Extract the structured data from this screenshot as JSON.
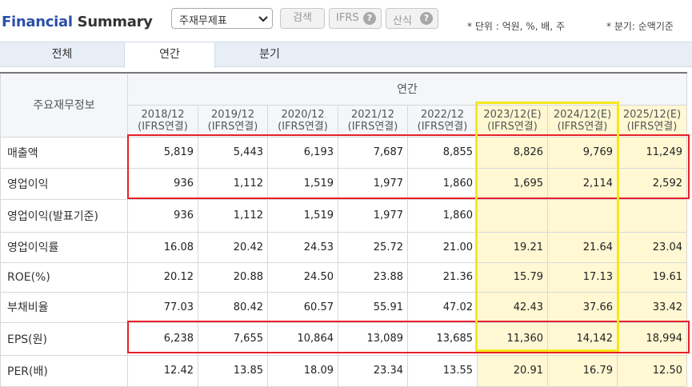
{
  "header": {
    "title_part1": "Financial",
    "title_part2": "Summary",
    "statement_select": "주재무제표",
    "search_label": "검색",
    "ifrs_label": "IFRS",
    "formula_label": "산식",
    "help_icon": "question-circle-icon",
    "unit_note": "* 단위 : 억원, %, 배, 주",
    "quarter_note": "* 분기: 순액기준"
  },
  "tabs": [
    "전체",
    "연간",
    "분기"
  ],
  "active_tab": "연간",
  "table": {
    "corner_label": "주요재무정보",
    "group_label": "연간",
    "columns": [
      {
        "period": "2018/12",
        "basis": "(IFRS연결)",
        "estimate": false
      },
      {
        "period": "2019/12",
        "basis": "(IFRS연결)",
        "estimate": false
      },
      {
        "period": "2020/12",
        "basis": "(IFRS연결)",
        "estimate": false
      },
      {
        "period": "2021/12",
        "basis": "(IFRS연결)",
        "estimate": false
      },
      {
        "period": "2022/12",
        "basis": "(IFRS연결)",
        "estimate": false
      },
      {
        "period": "2023/12(E)",
        "basis": "(IFRS연결)",
        "estimate": true
      },
      {
        "period": "2024/12(E)",
        "basis": "(IFRS연결)",
        "estimate": true
      },
      {
        "period": "2025/12(E)",
        "basis": "(IFRS연결)",
        "estimate": true
      }
    ],
    "rows": [
      {
        "label": "매출액",
        "values": [
          "5,819",
          "5,443",
          "6,193",
          "7,687",
          "8,855",
          "8,826",
          "9,769",
          "11,249"
        ]
      },
      {
        "label": "영업이익",
        "values": [
          "936",
          "1,112",
          "1,519",
          "1,977",
          "1,860",
          "1,695",
          "2,114",
          "2,592"
        ]
      },
      {
        "label": "영업이익(발표기준)",
        "values": [
          "936",
          "1,112",
          "1,519",
          "1,977",
          "1,860",
          "",
          "",
          ""
        ]
      },
      {
        "label": "영업이익률",
        "values": [
          "16.08",
          "20.42",
          "24.53",
          "25.72",
          "21.00",
          "19.21",
          "21.64",
          "23.04"
        ]
      },
      {
        "label": "ROE(%)",
        "values": [
          "20.12",
          "20.88",
          "24.50",
          "23.88",
          "21.36",
          "15.79",
          "17.13",
          "19.61"
        ]
      },
      {
        "label": "부채비율",
        "values": [
          "77.03",
          "80.42",
          "60.57",
          "55.91",
          "47.02",
          "42.43",
          "37.66",
          "33.42"
        ]
      },
      {
        "label": "EPS(원)",
        "values": [
          "6,238",
          "7,655",
          "10,864",
          "13,089",
          "13,685",
          "11,360",
          "14,142",
          "18,994"
        ]
      },
      {
        "label": "PER(배)",
        "values": [
          "12.42",
          "13.85",
          "18.09",
          "23.34",
          "13.55",
          "20.91",
          "16.79",
          "12.50"
        ]
      }
    ]
  },
  "colors": {
    "title_blue": "#2a4fa8",
    "estimate_bg": "#fff8d3",
    "highlight_red": "#e8202a",
    "highlight_yellow": "#f5e81c",
    "tab_bar_bg": "#e7eef6"
  }
}
